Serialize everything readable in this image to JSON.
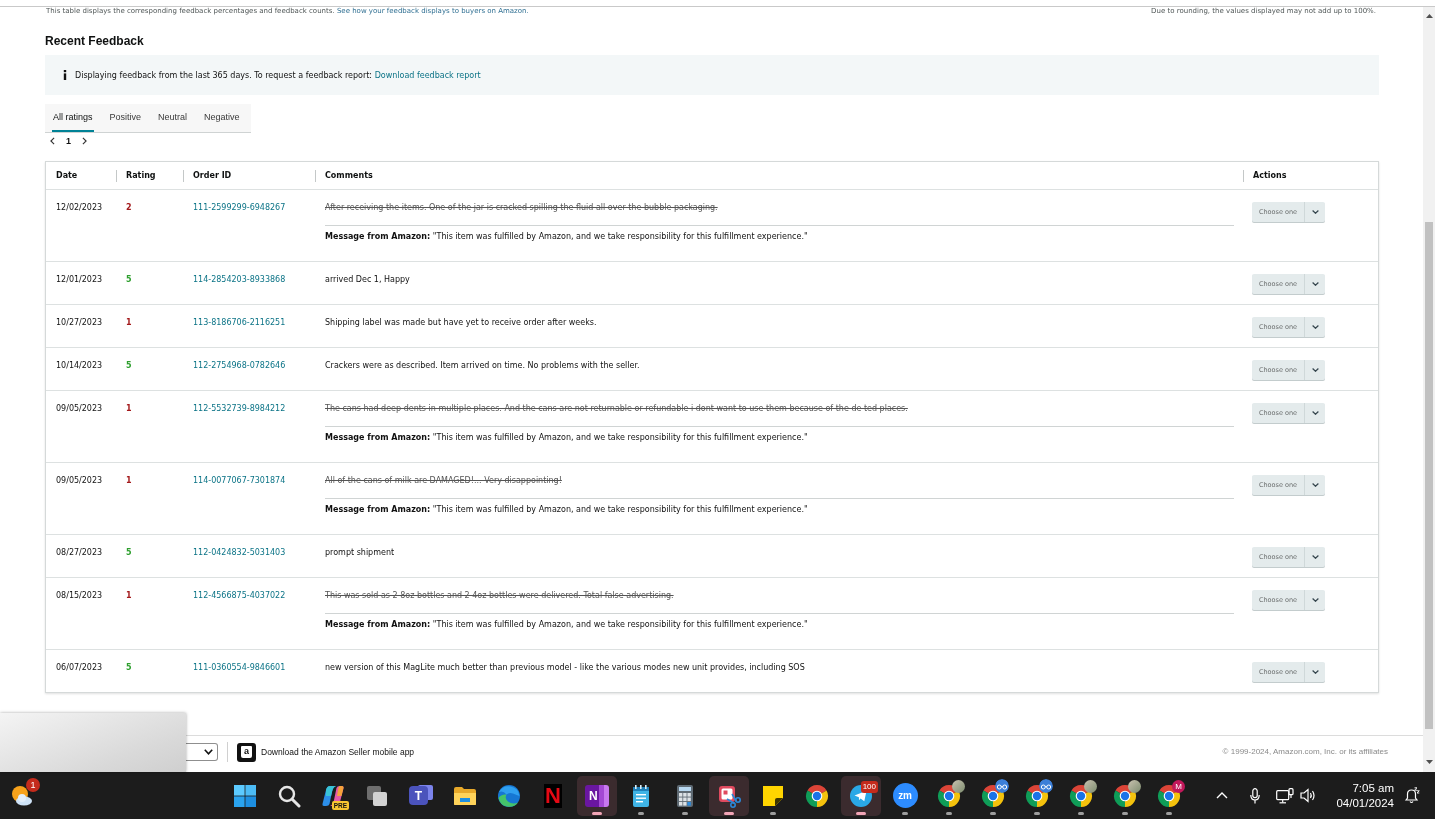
{
  "summary_note": {
    "text": "This table displays the corresponding feedback percentages and feedback counts.",
    "link": "See how your feedback displays to buyers on Amazon.",
    "rounding": "Due to rounding, the values displayed may not add up to 100%."
  },
  "section_title": "Recent Feedback",
  "info_banner": {
    "text": "Displaying feedback from the last 365 days. To request a feedback report:",
    "link": "Download feedback report"
  },
  "tabs": [
    {
      "label": "All ratings",
      "selected": true
    },
    {
      "label": "Positive",
      "selected": false
    },
    {
      "label": "Neutral",
      "selected": false
    },
    {
      "label": "Negative",
      "selected": false
    }
  ],
  "pagination": {
    "page": "1"
  },
  "table": {
    "columns": [
      "Date",
      "Rating",
      "Order ID",
      "Comments",
      "Actions"
    ],
    "rows": [
      {
        "date": "12/02/2023",
        "rating": "2",
        "color": "#a3191b",
        "order_id": "111-2599299-6948267",
        "comment": "After receiving the items. One of the jar is cracked spilling the fluid all over the bubble packaging.",
        "struck": true,
        "amazon_message": "**Message from Amazon:** \"This item was fulfilled by Amazon, and we take responsibility for this fulfillment experience.\"",
        "action": "Choose one"
      },
      {
        "date": "12/01/2023",
        "rating": "5",
        "color": "#2e9f2e",
        "order_id": "114-2854203-8933868",
        "comment": "arrived Dec 1, Happy",
        "struck": false,
        "action": "Choose one"
      },
      {
        "date": "10/27/2023",
        "rating": "1",
        "color": "#a3191b",
        "order_id": "113-8186706-2116251",
        "comment": "Shipping label was made but have yet to receive order after weeks.",
        "struck": false,
        "action": "Choose one"
      },
      {
        "date": "10/14/2023",
        "rating": "5",
        "color": "#2e9f2e",
        "order_id": "112-2754968-0782646",
        "comment": "Crackers were as described. Item arrived on time. No problems with the seller.",
        "struck": false,
        "action": "Choose one"
      },
      {
        "date": "09/05/2023",
        "rating": "1",
        "color": "#a3191b",
        "order_id": "112-5532739-8984212",
        "comment": "The cans had deep dents in multiple places. And the cans are not returnable or refundable i dont want to use them because of the de ted places.",
        "struck": true,
        "amazon_message": "**Message from Amazon:** \"This item was fulfilled by Amazon, and we take responsibility for this fulfillment experience.\"",
        "action": "Choose one"
      },
      {
        "date": "09/05/2023",
        "rating": "1",
        "color": "#a3191b",
        "order_id": "114-0077067-7301874",
        "comment": "All of the cans of milk are DAMAGED!... Very disappointing!",
        "struck": true,
        "amazon_message": "**Message from Amazon:** \"This item was fulfilled by Amazon, and we take responsibility for this fulfillment experience.\"",
        "action": "Choose one"
      },
      {
        "date": "08/27/2023",
        "rating": "5",
        "color": "#2e9f2e",
        "order_id": "112-0424832-5031403",
        "comment": "prompt shipment",
        "struck": false,
        "action": "Choose one"
      },
      {
        "date": "08/15/2023",
        "rating": "1",
        "color": "#a3191b",
        "order_id": "112-4566875-4037022",
        "comment": "This was sold as 2 8oz bottles and 2 4oz bottles were delivered. Total false advertising.",
        "struck": true,
        "amazon_message": "**Message from Amazon:** \"This item was fulfilled by Amazon, and we take responsibility for this fulfillment experience.\"",
        "action": "Choose one"
      },
      {
        "date": "06/07/2023",
        "rating": "5",
        "color": "#2e9f2e",
        "order_id": "111-0360554-9846601",
        "comment": "new version of this MagLite much better than previous model - like the various modes new unit provides, including SOS",
        "struck": false,
        "action": "Choose one"
      }
    ]
  },
  "footer": {
    "app_icon_label": "a",
    "app_link": "Download the Amazon Seller mobile app",
    "copyright": "© 1999-2024, Amazon.com, Inc. or its affiliates"
  },
  "taskbar": {
    "widgets_button": {
      "badge": "1"
    },
    "apps": [
      {
        "kind": "start",
        "running": false,
        "flashing": false
      },
      {
        "kind": "search",
        "running": false,
        "flashing": false
      },
      {
        "kind": "copilot",
        "badge": "PRE",
        "running": false,
        "flashing": false
      },
      {
        "kind": "task-view",
        "running": false,
        "flashing": false
      },
      {
        "kind": "teams",
        "label": "T",
        "running": false,
        "flashing": false
      },
      {
        "kind": "files",
        "running": false,
        "flashing": false
      },
      {
        "kind": "edge",
        "running": false,
        "flashing": false
      },
      {
        "kind": "netflix",
        "label": "N",
        "running": false,
        "flashing": false
      },
      {
        "kind": "onenote",
        "label": "N",
        "running": true,
        "flashing": true
      },
      {
        "kind": "notepad",
        "running": true,
        "flashing": false
      },
      {
        "kind": "calculator",
        "running": true,
        "flashing": false
      },
      {
        "kind": "snipping",
        "running": true,
        "flashing": true
      },
      {
        "kind": "sticky-notes",
        "running": true,
        "flashing": false
      },
      {
        "kind": "chrome",
        "running": false,
        "flashing": false
      },
      {
        "kind": "telegram",
        "badge": "100",
        "running": true,
        "flashing": true
      },
      {
        "kind": "zoom",
        "label": "zm",
        "running": true,
        "flashing": false
      },
      {
        "kind": "chrome",
        "avatar": {
          "kind": "photo"
        },
        "running": true,
        "flashing": false
      },
      {
        "kind": "chrome",
        "avatar": {
          "kind": "glasses"
        },
        "running": true,
        "flashing": false
      },
      {
        "kind": "chrome",
        "avatar": {
          "kind": "glasses"
        },
        "running": true,
        "flashing": false
      },
      {
        "kind": "chrome",
        "avatar": {
          "kind": "photo"
        },
        "running": true,
        "flashing": false
      },
      {
        "kind": "chrome",
        "avatar": {
          "kind": "photo"
        },
        "running": true,
        "flashing": false
      },
      {
        "kind": "chrome",
        "avatar": {
          "kind": "letter",
          "label": "M"
        },
        "running": true,
        "flashing": false
      }
    ],
    "clock": {
      "time": "7:05 am",
      "date": "04/01/2024"
    }
  }
}
